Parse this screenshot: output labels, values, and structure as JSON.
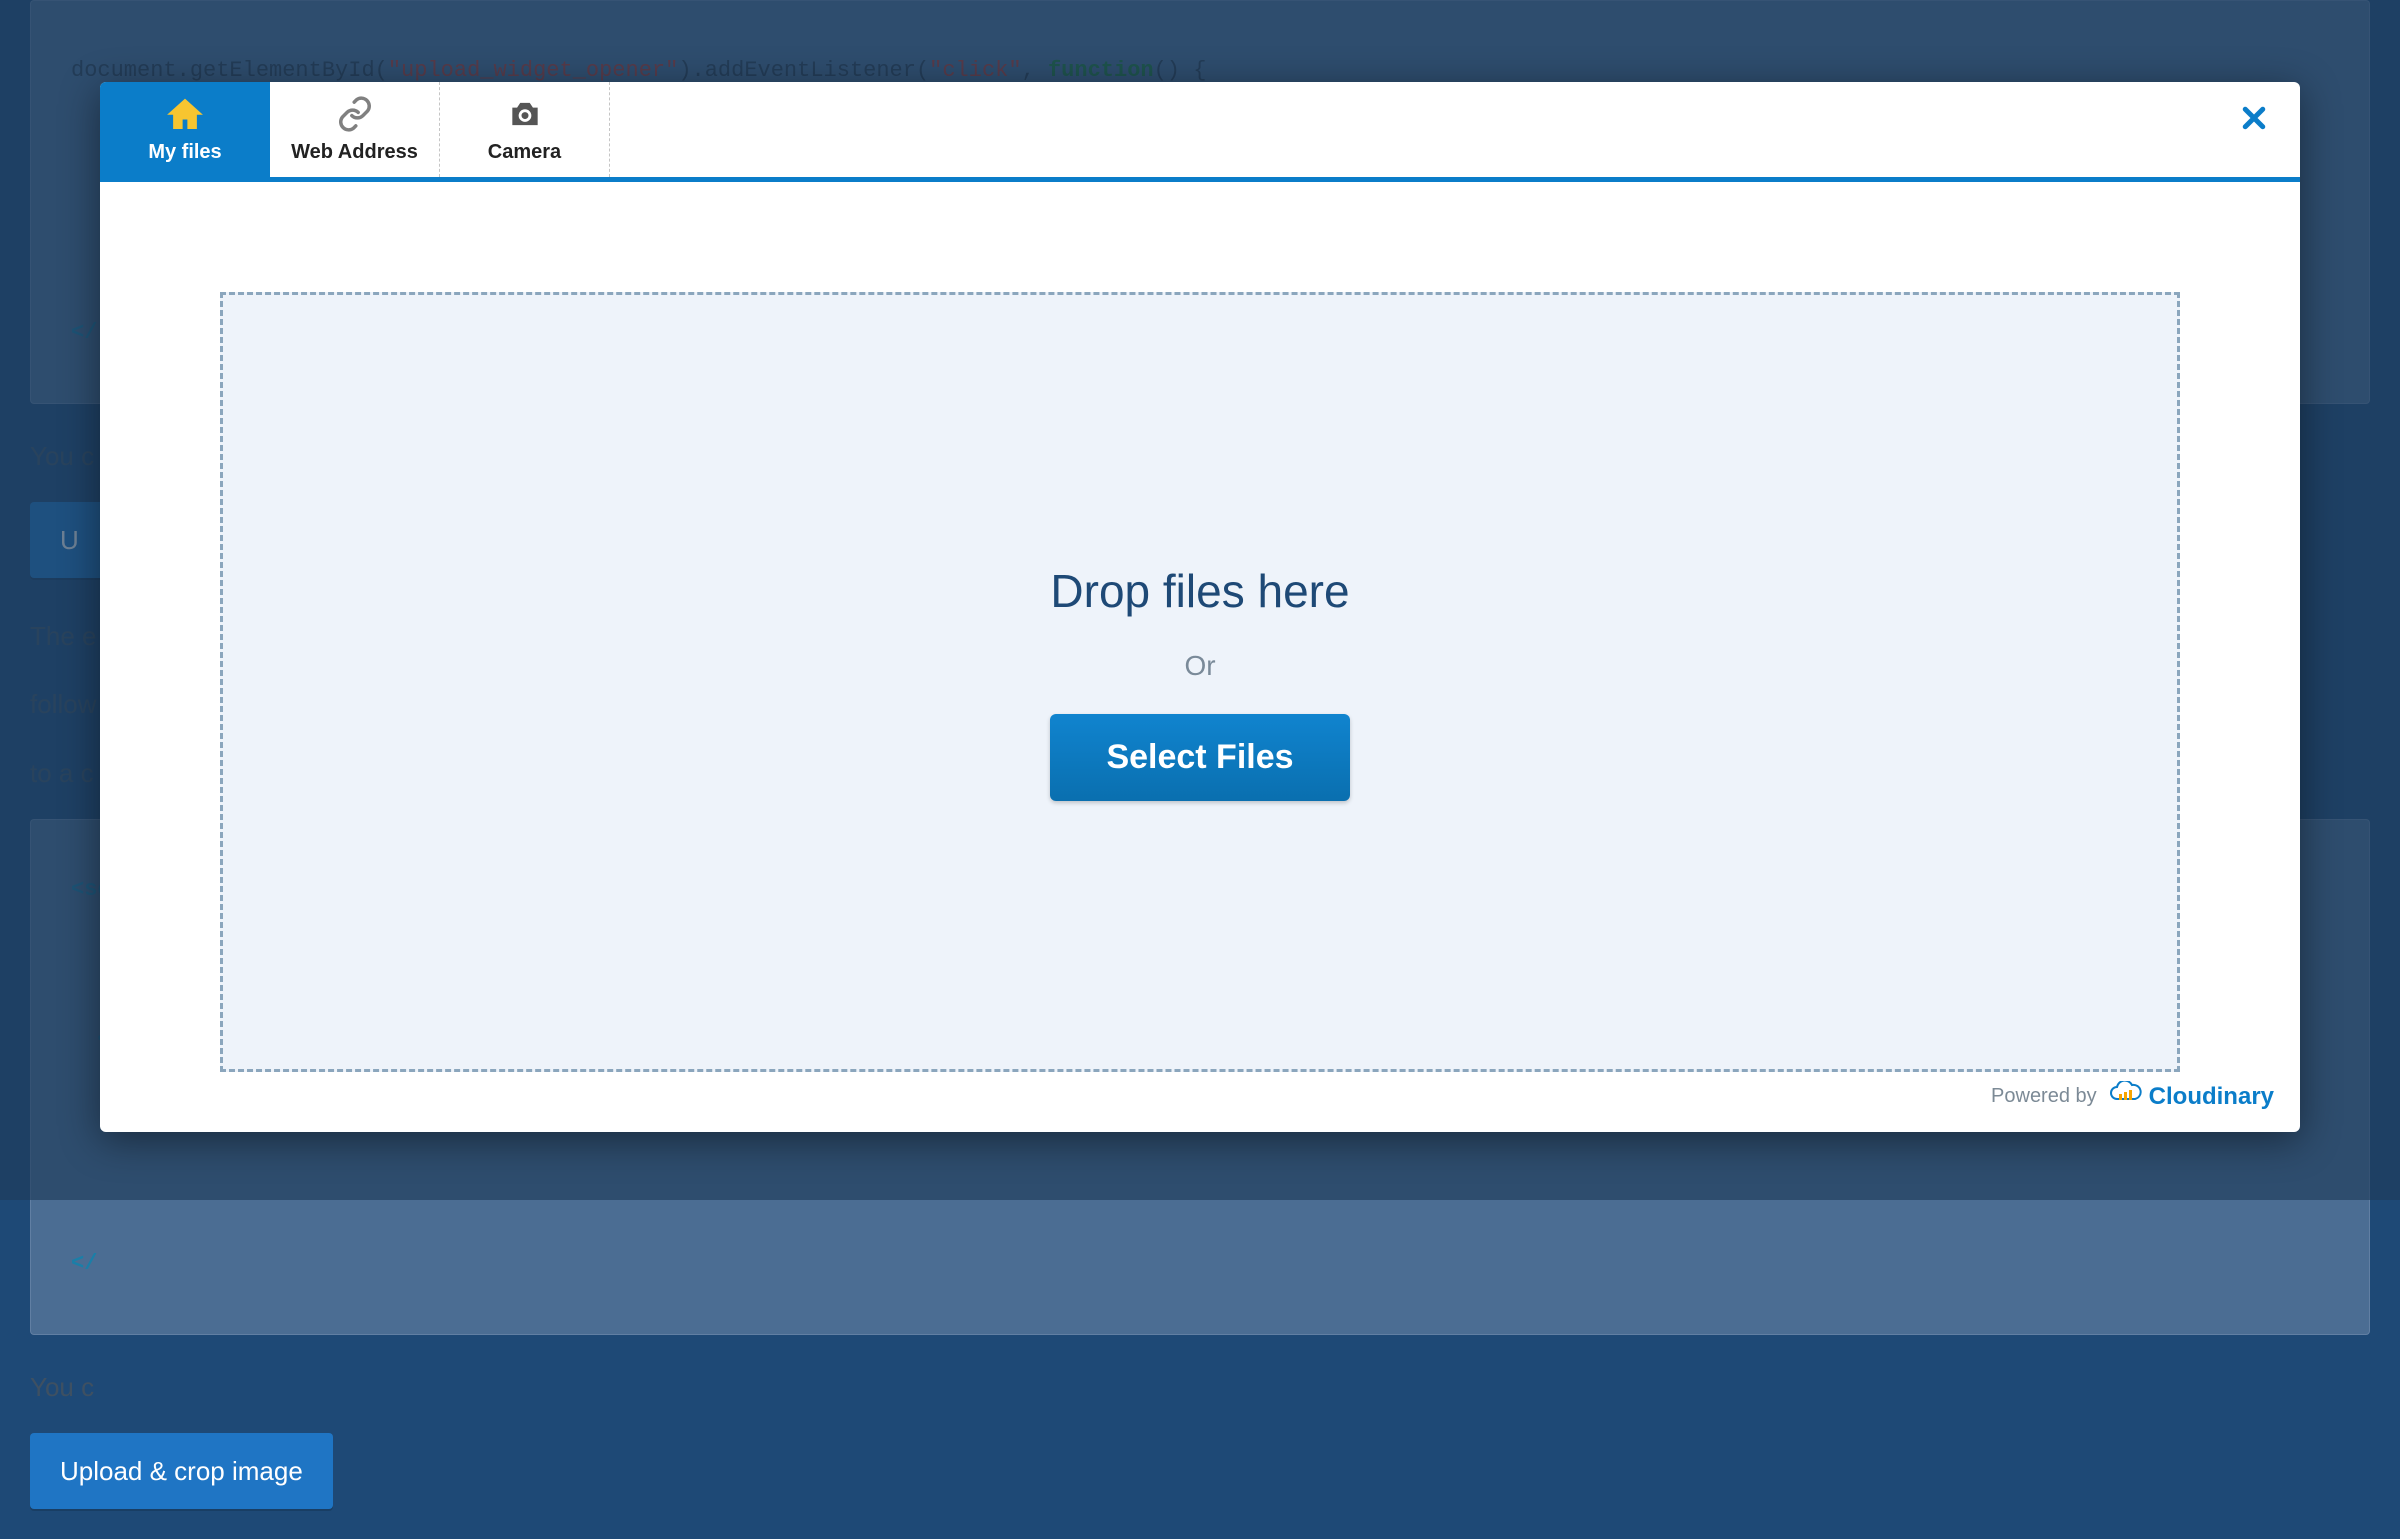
{
  "background": {
    "code_top_line_prefix": "document.getElementById(",
    "code_top_str": "\"upload_widget_opener\"",
    "code_top_mid": ").addEventListener(",
    "code_top_str2": "\"click\"",
    "code_top_mid2": ", ",
    "code_top_fn": "function",
    "code_top_suffix": "() {",
    "close_tag": "</",
    "text1": "You c",
    "button1": "U",
    "text2": "The e",
    "text3": "follow",
    "text4": "to a c",
    "open_script": "<scr",
    "open_s": "<s",
    "close_s": "</",
    "text5": "You c",
    "button2": "Upload & crop image"
  },
  "widget": {
    "tabs": [
      {
        "id": "my-files",
        "label": "My files",
        "active": true
      },
      {
        "id": "web-address",
        "label": "Web Address",
        "active": false
      },
      {
        "id": "camera",
        "label": "Camera",
        "active": false
      }
    ],
    "drop_title": "Drop files here",
    "or_label": "Or",
    "select_button": "Select Files",
    "powered_by": "Powered by",
    "brand": "Cloudinary"
  }
}
